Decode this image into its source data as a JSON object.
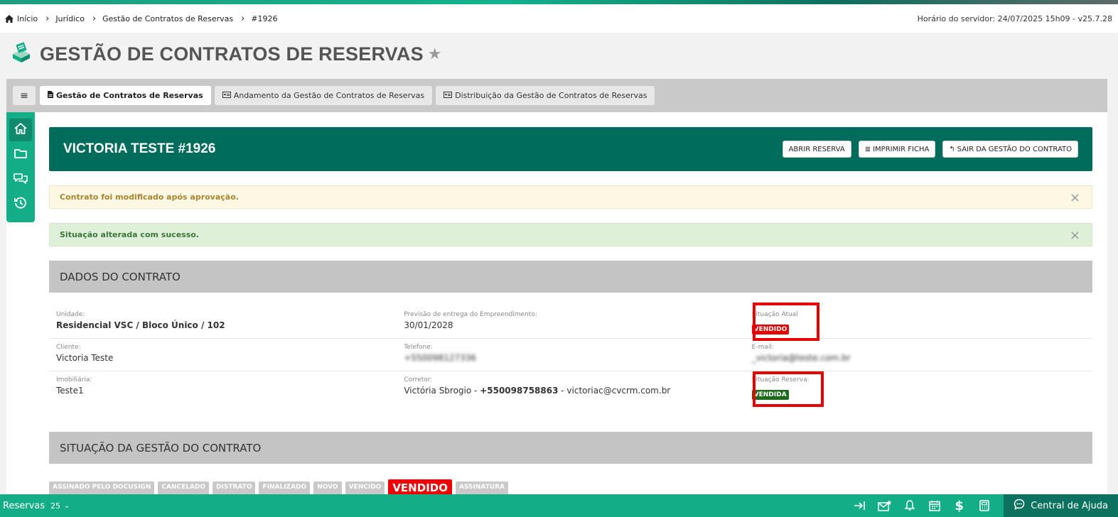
{
  "breadcrumb": [
    "Início",
    "Jurídico",
    "Gestão de Contratos de Reservas",
    "#1926"
  ],
  "server_time": "Horário do servidor: 24/07/2025 15h09 - v25.7.28",
  "page_title": "GESTÃO DE CONTRATOS DE RESERVAS",
  "tabs": [
    {
      "label": "Gestão de Contratos de Reservas",
      "icon": "document-icon",
      "active": true
    },
    {
      "label": "Andamento da Gestão de Contratos de Reservas",
      "icon": "id-card-icon",
      "active": false
    },
    {
      "label": "Distribuição da Gestão de Contratos de Reservas",
      "icon": "id-card-icon",
      "active": false
    }
  ],
  "sidebar": [
    "home-icon",
    "folder-icon",
    "chat-icon",
    "history-icon"
  ],
  "header": {
    "title": "VICTORIA TESTE #1926",
    "buttons": {
      "open": "ABRIR RESERVA",
      "print": "IMPRIMIR FICHA",
      "exit": "SAIR DA GESTÃO DO CONTRATO"
    }
  },
  "alerts": {
    "warning": "Contrato foi modificado após aprovação.",
    "success": "Situação alterada com sucesso.",
    "close": "×"
  },
  "contract": {
    "section_title": "DADOS DO CONTRATO",
    "unidade": {
      "label": "Unidade:",
      "value": "Residencial VSC / Bloco Único / 102"
    },
    "previsao": {
      "label": "Previsão de entrega do Empreendimento:",
      "value": "30/01/2028"
    },
    "situacao_atual": {
      "label": "Situação Atual",
      "value": "VENDIDO"
    },
    "cliente": {
      "label": "Cliente:",
      "value": "Victoria Teste"
    },
    "telefone": {
      "label": "Telefone:",
      "value": "+550098127336"
    },
    "email": {
      "label": "E-mail:",
      "value": "_victoria@teste.com.br"
    },
    "imobiliaria": {
      "label": "Imobiliária:",
      "value": "Teste1"
    },
    "corretor": {
      "label": "Corretor:",
      "name": "Victória Sbrogio",
      "sep": " - ",
      "phone": "+550098758863",
      "email": "victoriac@cvcrm.com.br"
    },
    "situacao_reserva": {
      "label": "Situação Reserva:",
      "value": "VENDIDA"
    }
  },
  "situacao_section": {
    "title": "SITUAÇÃO DA GESTÃO DO CONTRATO",
    "statuses": [
      "ASSINADO PELO DOCUSIGN",
      "CANCELADO",
      "DISTRATO",
      "FINALIZADO",
      "NOVO",
      "VENCIDO",
      "VENDIDO",
      "ASSINATURA"
    ],
    "current": "VENDIDO"
  },
  "bottombar": {
    "label": "Reservas",
    "count": "25",
    "icons": [
      "collapse-right-icon",
      "mail-star-icon",
      "bell-icon",
      "calendar-icon",
      "dollar-icon",
      "calculator-icon"
    ],
    "help": "Central de Ajuda"
  },
  "colors": {
    "primary": "#006c5b",
    "accent": "#13ad87",
    "danger": "#e00000",
    "success": "#1d6a1d"
  }
}
